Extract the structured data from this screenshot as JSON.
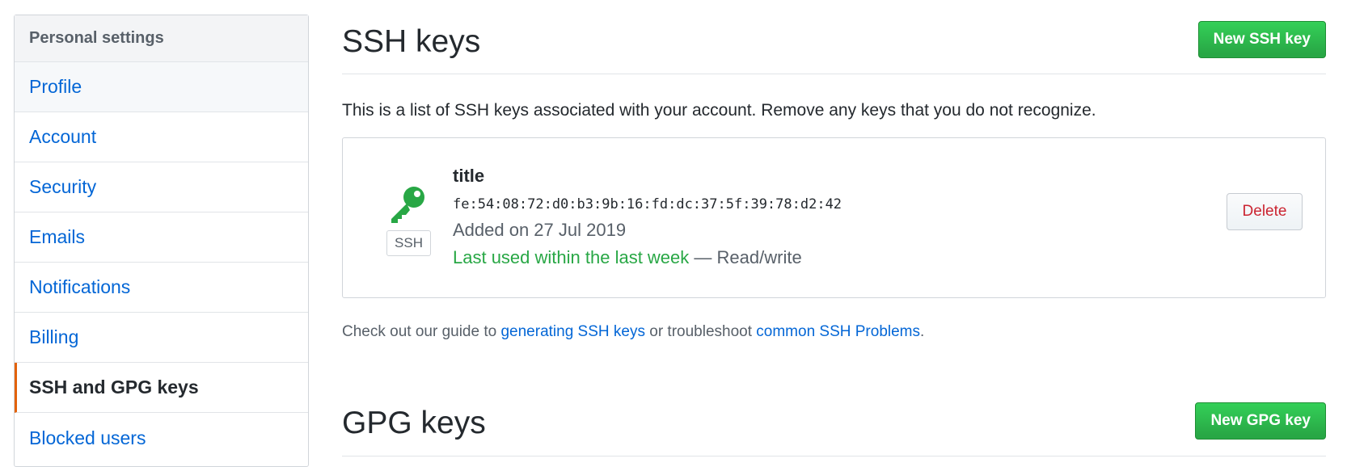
{
  "sidebar": {
    "header": "Personal settings",
    "items": [
      {
        "label": "Profile"
      },
      {
        "label": "Account"
      },
      {
        "label": "Security"
      },
      {
        "label": "Emails"
      },
      {
        "label": "Notifications"
      },
      {
        "label": "Billing"
      },
      {
        "label": "SSH and GPG keys",
        "selected": true
      },
      {
        "label": "Blocked users"
      }
    ]
  },
  "ssh": {
    "title": "SSH keys",
    "new_button": "New SSH key",
    "intro": "This is a list of SSH keys associated with your account. Remove any keys that you do not recognize.",
    "keys": [
      {
        "title": "title",
        "fingerprint": "fe:54:08:72:d0:b3:9b:16:fd:dc:37:5f:39:78:d2:42",
        "added": "Added on 27 Jul 2019",
        "last_used": "Last used within the last week",
        "access": "— Read/write",
        "type": "SSH",
        "icon": "key-icon",
        "delete_label": "Delete"
      }
    ],
    "guide": {
      "prefix": "Check out our guide to ",
      "link1": "generating SSH keys",
      "middle": " or troubleshoot ",
      "link2": "common SSH Problems",
      "suffix": "."
    }
  },
  "gpg": {
    "title": "GPG keys",
    "new_button": "New GPG key"
  },
  "colors": {
    "link": "#0366d6",
    "primary_green": "#28a745",
    "danger_red": "#cb2431",
    "selected_accent": "#e36209"
  }
}
